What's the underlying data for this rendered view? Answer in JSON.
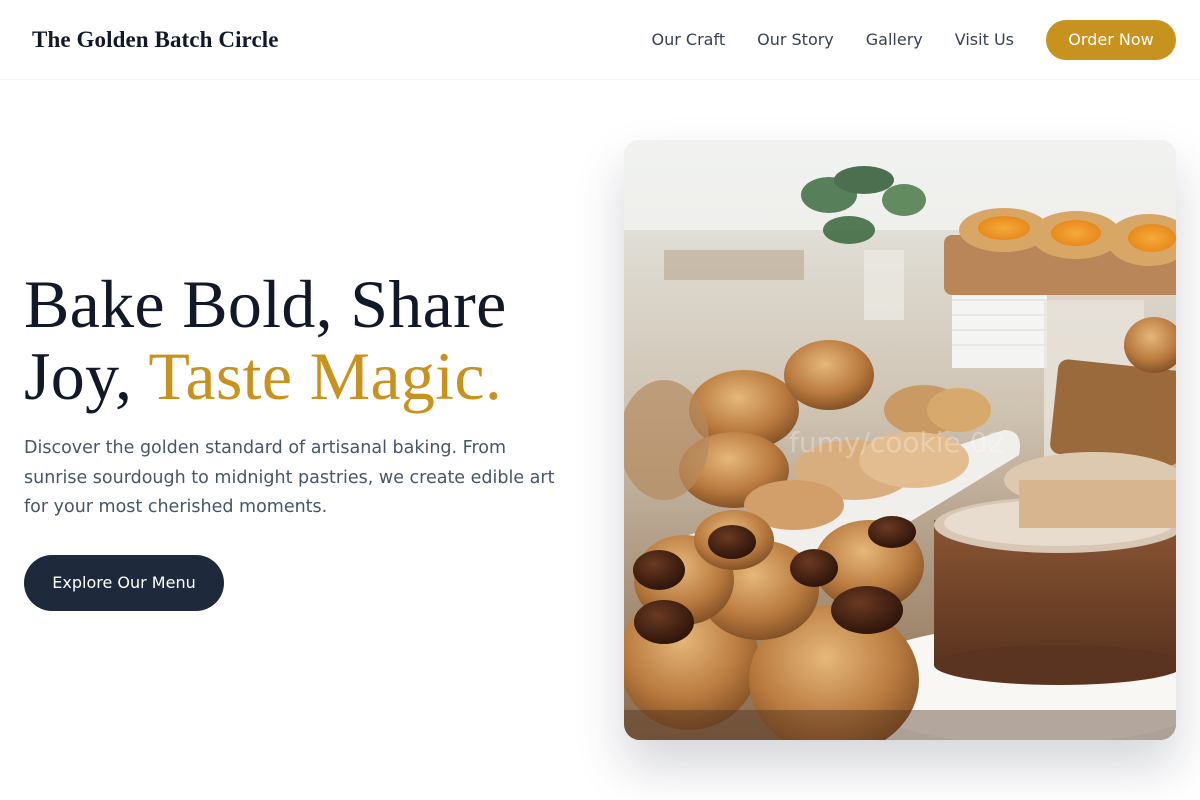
{
  "header": {
    "brand": "The Golden Batch Circle",
    "nav": [
      "Our Craft",
      "Our Story",
      "Gallery",
      "Visit Us"
    ],
    "order_label": "Order Now"
  },
  "hero": {
    "title_line1": "Bake Bold, Share",
    "title_line2_plain": "Joy, ",
    "title_line2_accent": "Taste Magic.",
    "description": "Discover the golden standard of artisanal baking. From sunrise sourdough to midnight pastries, we create edible art for your most cherished moments.",
    "cta_label": "Explore Our Menu",
    "image_watermark": "fumy/cookie 02"
  },
  "colors": {
    "accent": "#c8921f",
    "dark": "#1e293b",
    "text_muted": "#475569"
  }
}
